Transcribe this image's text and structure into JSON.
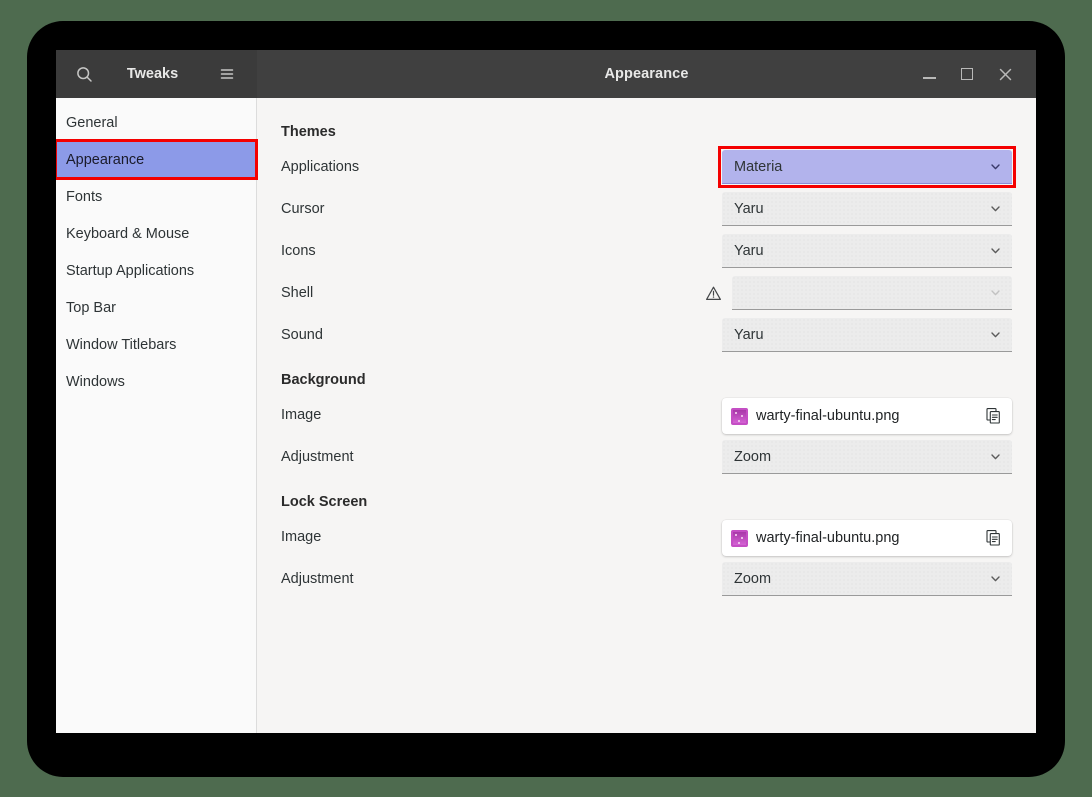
{
  "app": {
    "name": "Tweaks",
    "window_title": "Appearance"
  },
  "header": {
    "search_icon": "search-icon",
    "app_title": "Tweaks",
    "menu_icon": "hamburger-menu-icon",
    "title": "Appearance",
    "minimize_label": "–",
    "maximize_label": "□",
    "close_label": "✕"
  },
  "sidebar": {
    "items": [
      {
        "label": "General",
        "selected": false
      },
      {
        "label": "Appearance",
        "selected": true
      },
      {
        "label": "Fonts",
        "selected": false
      },
      {
        "label": "Keyboard & Mouse",
        "selected": false
      },
      {
        "label": "Startup Applications",
        "selected": false
      },
      {
        "label": "Top Bar",
        "selected": false
      },
      {
        "label": "Window Titlebars",
        "selected": false
      },
      {
        "label": "Windows",
        "selected": false
      }
    ]
  },
  "main": {
    "themes": {
      "title": "Themes",
      "rows": [
        {
          "label": "Applications",
          "value": "Materia",
          "disabled": false,
          "warning": false,
          "highlighted": true
        },
        {
          "label": "Cursor",
          "value": "Yaru",
          "disabled": false,
          "warning": false,
          "highlighted": false
        },
        {
          "label": "Icons",
          "value": "Yaru",
          "disabled": false,
          "warning": false,
          "highlighted": false
        },
        {
          "label": "Shell",
          "value": "",
          "disabled": true,
          "warning": true,
          "highlighted": false
        },
        {
          "label": "Sound",
          "value": "Yaru",
          "disabled": false,
          "warning": false,
          "highlighted": false
        }
      ]
    },
    "background": {
      "title": "Background",
      "image_label": "Image",
      "image_value": "warty-final-ubuntu.png",
      "adjustment_label": "Adjustment",
      "adjustment_value": "Zoom"
    },
    "lock_screen": {
      "title": "Lock Screen",
      "image_label": "Image",
      "image_value": "warty-final-ubuntu.png",
      "adjustment_label": "Adjustment",
      "adjustment_value": "Zoom"
    }
  },
  "colors": {
    "accent_selection": "#8c9ae8",
    "highlight_outline": "#f40000",
    "combo_selected": "#b2b3ec",
    "headerbar": "#3d3d3d",
    "desktop": "#4e6b4f"
  }
}
